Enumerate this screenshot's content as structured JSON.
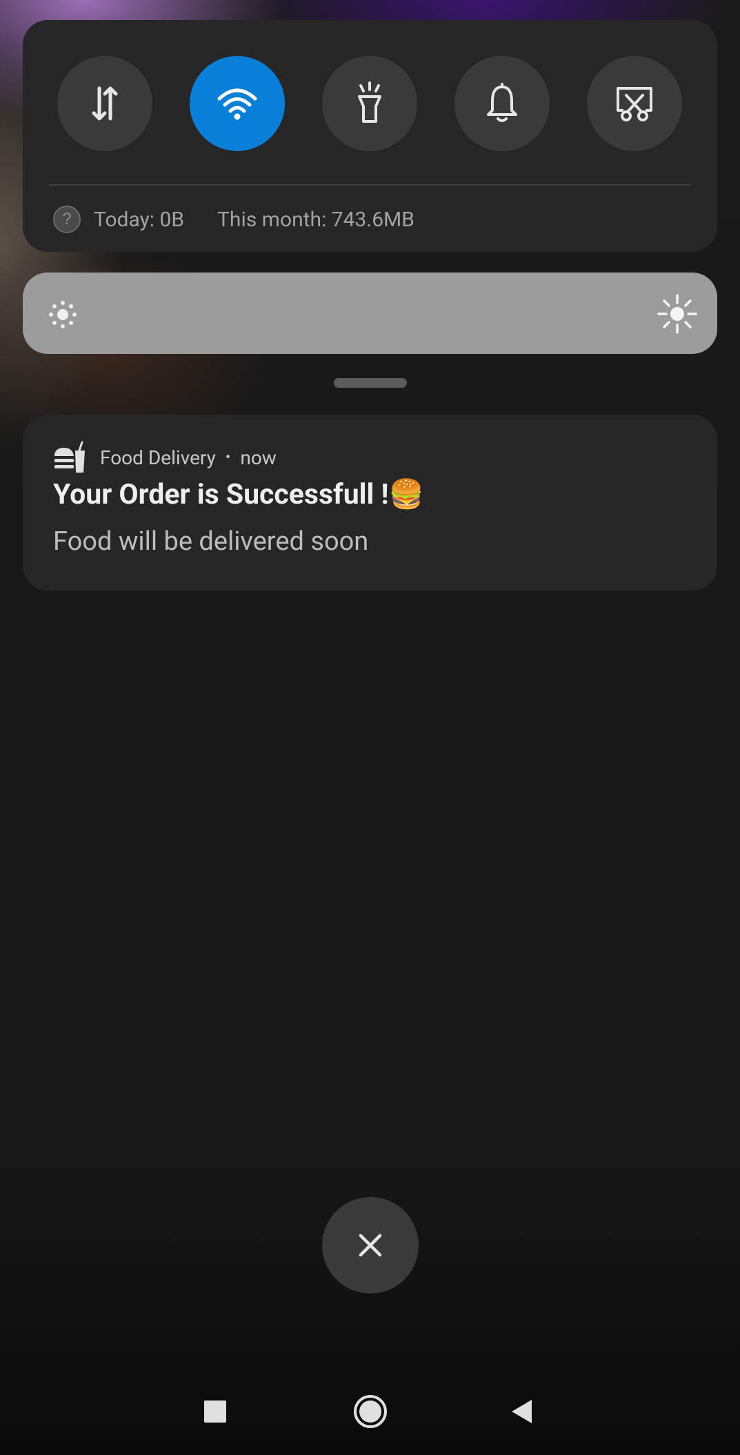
{
  "quick_settings": {
    "tiles": [
      {
        "icon": "mobile-data-icon",
        "active": false
      },
      {
        "icon": "wifi-icon",
        "active": true
      },
      {
        "icon": "flashlight-icon",
        "active": false
      },
      {
        "icon": "bell-icon",
        "active": false
      },
      {
        "icon": "screenshot-icon",
        "active": false
      }
    ],
    "data_usage": {
      "help_glyph": "?",
      "today": "Today: 0B",
      "month": "This month: 743.6MB"
    },
    "accent_color": "#0a7fd8"
  },
  "brightness": {
    "icon_low": "brightness-low-icon",
    "icon_high": "brightness-high-icon"
  },
  "notification": {
    "app_icon": "food-delivery-icon",
    "app_name": "Food Delivery",
    "separator": "•",
    "time": "now",
    "title": "Your Order is Successfull !🍔",
    "body": "Food will be delivered soon"
  },
  "dismiss_all": {
    "icon": "close-icon"
  },
  "navigation": {
    "recents": "recents-icon",
    "home": "home-icon",
    "back": "back-icon"
  }
}
